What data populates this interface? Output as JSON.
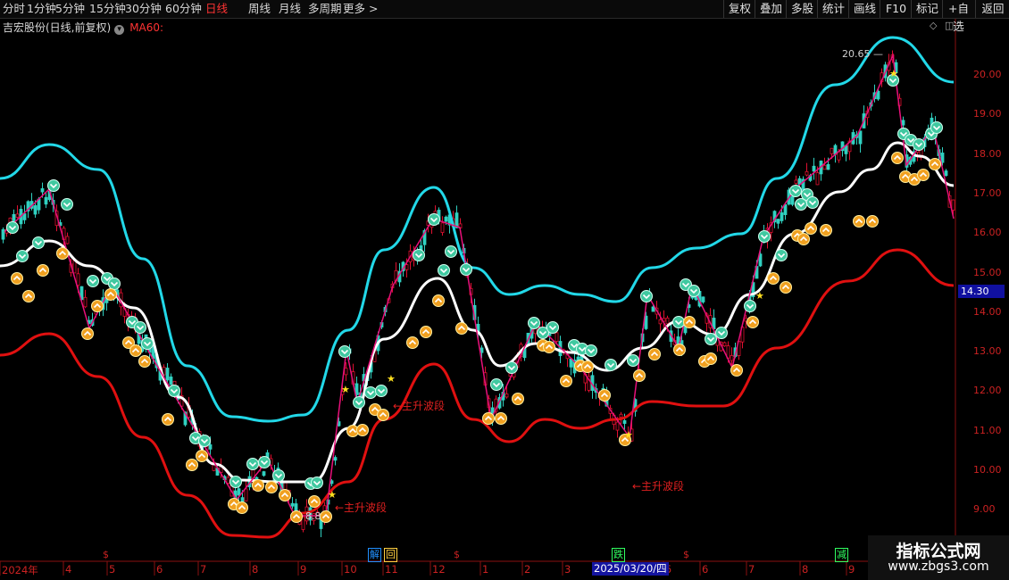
{
  "toolbar": {
    "periods": [
      "分时",
      "1分钟",
      "5分钟",
      "15分钟",
      "30分钟",
      "60分钟",
      "日线",
      "周线",
      "月线",
      "多周期",
      "更多 >"
    ],
    "active_period": "日线",
    "buttons": [
      "复权",
      "叠加",
      "多股",
      "统计",
      "画线",
      "F10",
      "标记",
      "+自选",
      "返回"
    ]
  },
  "stock": {
    "title": "吉宏股份(日线,前复权)",
    "indicator": "MA60:"
  },
  "price_axis": [
    "20.00",
    "19.00",
    "18.00",
    "17.00",
    "16.00",
    "15.00",
    "14.00",
    "13.00",
    "12.00",
    "11.00",
    "10.00",
    "9.00"
  ],
  "last_price": "14.30",
  "date_axis": [
    "2024年",
    "4",
    "5",
    "6",
    "7",
    "8",
    "9",
    "10",
    "11",
    "12",
    "1",
    "2",
    "3",
    "5",
    "6",
    "7",
    "8",
    "9"
  ],
  "date_cursor": "2025/03/20/四",
  "event_markers": [
    {
      "label": "解",
      "color": "#2090ff"
    },
    {
      "label": "回",
      "color": "#ffd040"
    },
    {
      "label": "跌",
      "color": "#30ff60"
    },
    {
      "label": "减",
      "color": "#30ff60"
    }
  ],
  "dollar_marker": "$",
  "annotations": {
    "high_price": "20.65",
    "low_price": "8.8",
    "wave1": "←主升波段",
    "wave2": "←主升波段",
    "wave3": "←主升波段"
  },
  "watermark": {
    "title": "指标公式网",
    "url": "www.zbgs3.com"
  },
  "colors": {
    "upper_band": "#22d8e8",
    "lower_band": "#e01010",
    "ma": "#ffffff",
    "up_candle": "#e01030",
    "down_candle": "#30d0c0",
    "zigzag": "#e8107a"
  },
  "chart_data": {
    "type": "candlestick",
    "title": "吉宏股份(日线,前复权)",
    "ylim": [
      8.5,
      21.0
    ],
    "high": 20.65,
    "low": 8.8,
    "last": 14.3,
    "x": [
      "2024-03",
      "2024-04",
      "2024-05",
      "2024-06",
      "2024-07",
      "2024-08",
      "2024-09",
      "2024-10",
      "2024-11",
      "2024-12",
      "2025-01",
      "2025-02",
      "2025-03",
      "2025-04",
      "2025-05",
      "2025-06",
      "2025-07",
      "2025-08",
      "2025-09",
      "2025-10"
    ],
    "series": [
      {
        "name": "",
        "values": [
          15.1,
          16.8,
          15.0,
          13.5,
          11.0,
          9.7,
          9.3,
          11.5,
          13.5,
          15.5,
          12.0,
          13.2,
          13.0,
          11.5,
          12.8,
          13.5,
          15.0,
          17.0,
          19.5,
          16.3
        ]
      }
    ]
  }
}
